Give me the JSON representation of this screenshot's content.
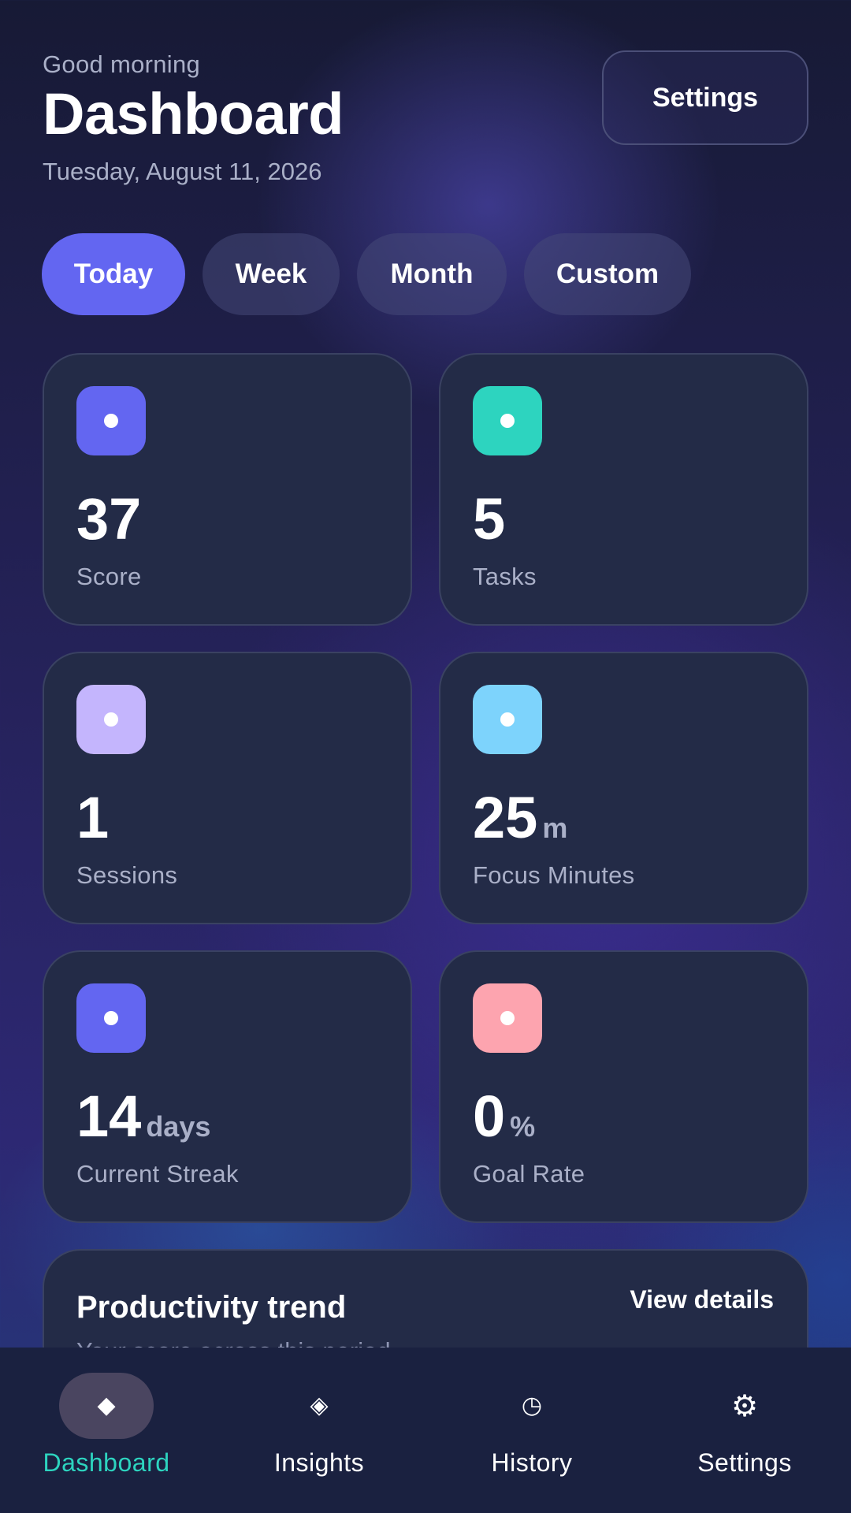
{
  "header": {
    "greeting": "Good morning",
    "title": "Dashboard",
    "date": "Tuesday, August 11, 2026",
    "settings_label": "Settings"
  },
  "segments": [
    {
      "label": "Today",
      "active": true
    },
    {
      "label": "Week",
      "active": false
    },
    {
      "label": "Month",
      "active": false
    },
    {
      "label": "Custom",
      "active": false
    }
  ],
  "cards": [
    {
      "value": "37",
      "unit": "",
      "label": "Score",
      "icon_color": "#6366f1",
      "icon": "dot-icon"
    },
    {
      "value": "5",
      "unit": "",
      "label": "Tasks",
      "icon_color": "#2dd4bf",
      "icon": "dot-icon"
    },
    {
      "value": "1",
      "unit": "",
      "label": "Sessions",
      "icon_color": "#c4b5fd",
      "icon": "dot-icon"
    },
    {
      "value": "25",
      "unit": "m",
      "label": "Focus Minutes",
      "icon_color": "#7dd3fc",
      "icon": "dot-icon"
    },
    {
      "value": "14",
      "unit": "days",
      "label": "Current Streak",
      "icon_color": "#6366f1",
      "icon": "dot-icon"
    },
    {
      "value": "0",
      "unit": "%",
      "label": "Goal Rate",
      "icon_color": "#fda4af",
      "icon": "dot-icon"
    }
  ],
  "trend": {
    "title": "Productivity trend",
    "subtitle": "Your score across this period",
    "link": "View details"
  },
  "nav": [
    {
      "label": "Dashboard",
      "icon": "◆",
      "icon_name": "diamond-filled-icon",
      "active": true
    },
    {
      "label": "Insights",
      "icon": "◈",
      "icon_name": "diamond-outline-icon",
      "active": false
    },
    {
      "label": "History",
      "icon": "◷",
      "icon_name": "clock-icon",
      "active": false
    },
    {
      "label": "Settings",
      "icon": "⚙",
      "icon_name": "gear-icon",
      "active": false
    }
  ],
  "colors": {
    "accent": "#6366f1",
    "active_nav": "#2dd4bf",
    "card_bg": "#232b47"
  }
}
